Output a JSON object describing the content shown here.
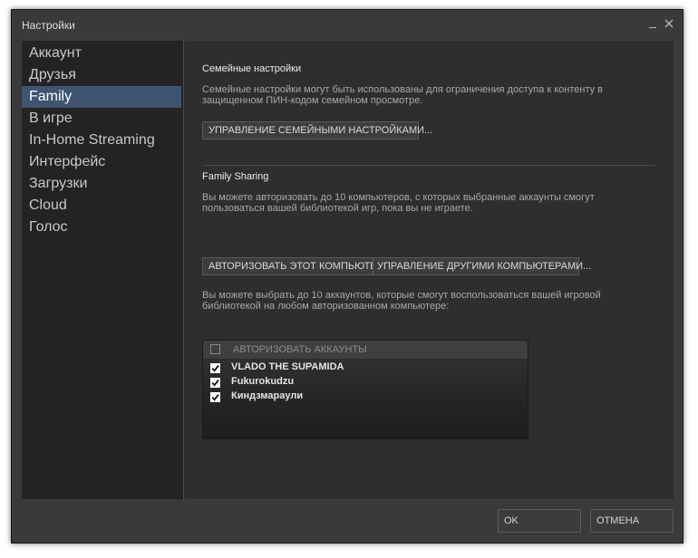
{
  "window": {
    "title": "Настройки",
    "minimize_symbol": "_",
    "close_symbol": "✕"
  },
  "sidebar": {
    "items": [
      {
        "label": "Аккаунт"
      },
      {
        "label": "Друзья"
      },
      {
        "label": "Family",
        "active": true
      },
      {
        "label": "В игре"
      },
      {
        "label": "In-Home Streaming"
      },
      {
        "label": "Интерфейс"
      },
      {
        "label": "Загрузки"
      },
      {
        "label": "Cloud"
      },
      {
        "label": "Голос"
      }
    ]
  },
  "family_settings": {
    "title": "Семейные настройки",
    "description_line1": "Семейные настройки могут быть использованы для ограничения доступа к контенту в",
    "description_line2": "защищенном ПИН-кодом семейном просмотре.",
    "manage_button": "УПРАВЛЕНИЕ СЕМЕЙНЫМИ НАСТРОЙКАМИ..."
  },
  "family_sharing": {
    "title": "Family Sharing",
    "description_line1": "Вы можете авторизовать до 10 компьютеров, с которых выбранные аккаунты смогут",
    "description_line2": "пользоваться вашей библиотекой игр, пока вы не играете.",
    "authorize_button": "АВТОРИЗОВАТЬ ЭТОТ КОМПЬЮТЕР...",
    "manage_computers_button": "УПРАВЛЕНИЕ ДРУГИМИ КОМПЬЮТЕРАМИ...",
    "accounts_desc_line1": "Вы можете выбрать до 10 аккаунтов, которые смогут воспользоваться вашей игровой",
    "accounts_desc_line2": "библиотекой на любом авторизованном компьютере:"
  },
  "accounts": {
    "header": "АВТОРИЗОВАТЬ АККАУНТЫ",
    "header_checked": false,
    "rows": [
      {
        "name": "VLADO THE SUPAMIDA",
        "checked": true
      },
      {
        "name": "Fukurokudzu",
        "checked": true
      },
      {
        "name": "Киндзмараули",
        "checked": true
      }
    ]
  },
  "footer": {
    "ok_label": "OK",
    "cancel_label": "ОТМЕНА"
  },
  "colors": {
    "window_bg": "#3a3a3a",
    "sidebar_bg": "#232323",
    "content_bg": "#2e2e2e",
    "active_item": "#3e5470"
  }
}
